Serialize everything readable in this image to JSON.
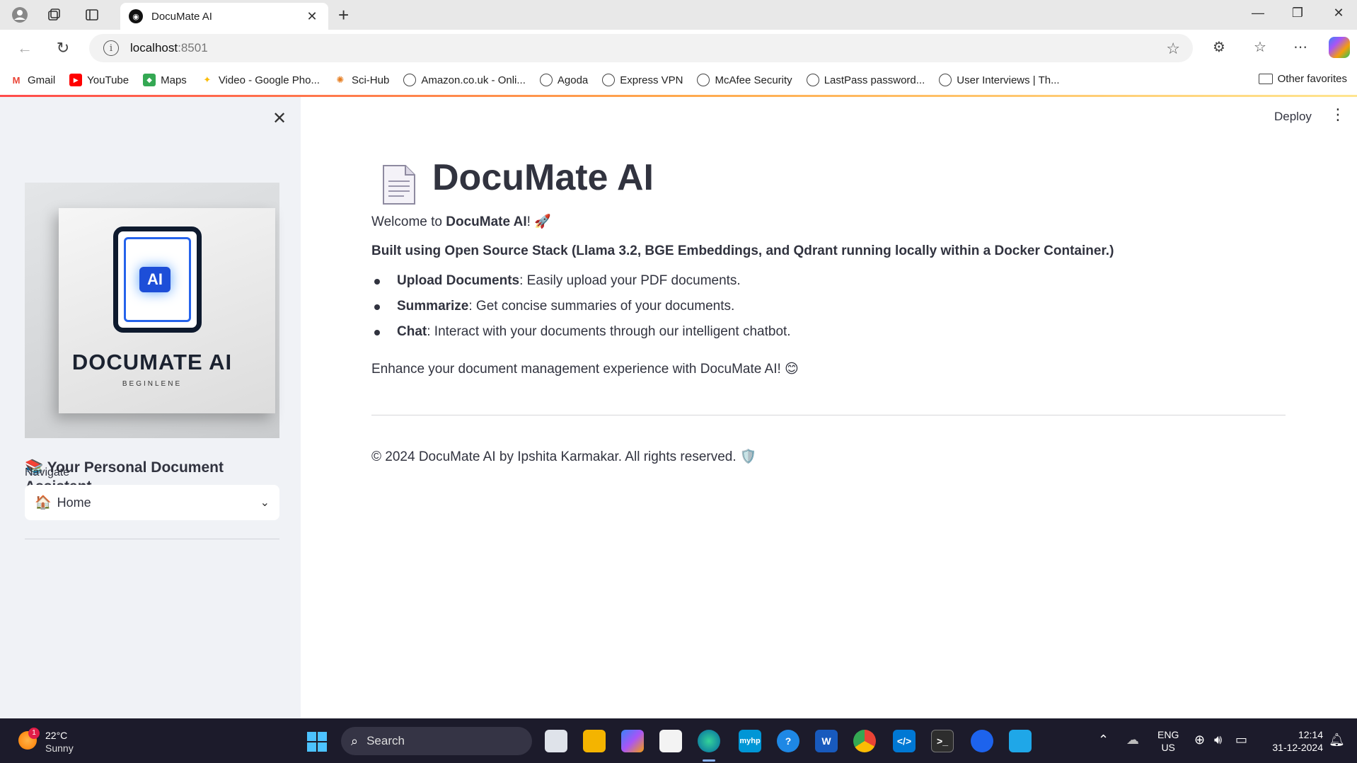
{
  "browser": {
    "tab_title": "DocuMate AI",
    "url_host": "localhost",
    "url_port": ":8501",
    "bookmarks": [
      "Gmail",
      "YouTube",
      "Maps",
      "Video - Google Pho...",
      "Sci-Hub",
      "Amazon.co.uk - Onli...",
      "Agoda",
      "Express VPN",
      "McAfee Security",
      "LastPass password...",
      "User Interviews | Th..."
    ],
    "other_favorites": "Other favorites"
  },
  "sidebar": {
    "logo_text": "DOCUMATE AI",
    "logo_sub": "BEGINLENE",
    "logo_badge": "AI",
    "tagline_emoji": "📚",
    "tagline": "Your Personal Document Assistant",
    "nav_label": "Navigate",
    "select_emoji": "🏠",
    "select_value": "Home"
  },
  "header": {
    "deploy": "Deploy"
  },
  "main": {
    "title": "DocuMate AI",
    "welcome_prefix": "Welcome to ",
    "welcome_bold": "DocuMate AI",
    "welcome_suffix": "! 🚀",
    "built_using": "Built using Open Source Stack (Llama 3.2, BGE Embeddings, and Qdrant running locally within a Docker Container.)",
    "features": [
      {
        "name": "Upload Documents",
        "desc": ": Easily upload your PDF documents."
      },
      {
        "name": "Summarize",
        "desc": ": Get concise summaries of your documents."
      },
      {
        "name": "Chat",
        "desc": ": Interact with your documents through our intelligent chatbot."
      }
    ],
    "enhance": "Enhance your document management experience with DocuMate AI! 😊",
    "footer": "© 2024 DocuMate AI by Ipshita Karmakar. All rights reserved.",
    "footer_emoji": "🛡️"
  },
  "taskbar": {
    "weather_badge": "1",
    "temperature": "22°C",
    "weather": "Sunny",
    "search_label": "Search",
    "lang_top": "ENG",
    "lang_bottom": "US",
    "time": "12:14",
    "date": "31-12-2024"
  }
}
